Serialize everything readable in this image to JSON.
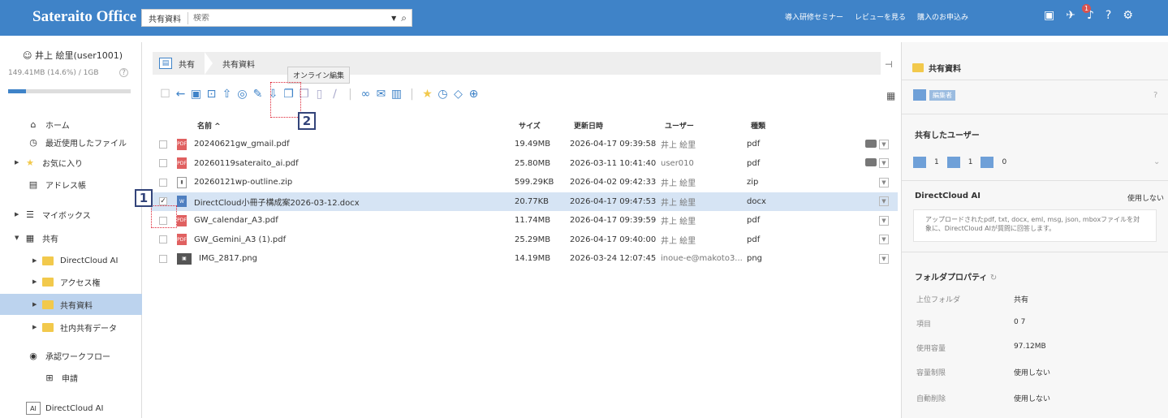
{
  "header": {
    "logo": "Sateraito Office",
    "scope": "共有資料",
    "search_placeholder": "検索",
    "links": [
      "導入研修セミナー",
      "レビューを見る",
      "購入のお申込み"
    ],
    "notif": "1"
  },
  "sidebar": {
    "user": "井上 絵里(user1001)",
    "quota": "149.41MB (14.6%) / 1GB",
    "quota_pct": 14.6,
    "items": [
      "ホーム",
      "最近使用したファイル",
      "お気に入り",
      "アドレス帳",
      "マイボックス",
      "共有",
      "DirectCloud AI",
      "アクセス権",
      "共有資料",
      "社内共有データ",
      "承認ワークフロー",
      "申請",
      "DirectCloud AI"
    ]
  },
  "breadcrumb": [
    "共有",
    "共有資料"
  ],
  "tooltip": "オンライン編集",
  "annotations": [
    "1",
    "2"
  ],
  "table": {
    "headers": [
      "名前 ^",
      "サイズ",
      "更新日時",
      "ユーザー",
      "種類"
    ],
    "rows": [
      {
        "name": "20240621gw_gmail.pdf",
        "size": "19.49MB",
        "date": "2026-04-17 09:39:58",
        "user": "井上 絵里",
        "type": "pdf"
      },
      {
        "name": "20260119sateraito_ai.pdf",
        "size": "25.80MB",
        "date": "2026-03-11 10:41:40",
        "user": "user010",
        "type": "pdf"
      },
      {
        "name": "20260121wp-outline.zip",
        "size": "599.29KB",
        "date": "2026-04-02 09:42:33",
        "user": "井上 絵里",
        "type": "zip"
      },
      {
        "name": "DirectCloud小冊子構成案2026-03-12.docx",
        "size": "20.77KB",
        "date": "2026-04-17 09:47:53",
        "user": "井上 絵里",
        "type": "docx"
      },
      {
        "name": "GW_calendar_A3.pdf",
        "size": "11.74MB",
        "date": "2026-04-17 09:39:59",
        "user": "井上 絵里",
        "type": "pdf"
      },
      {
        "name": "GW_Gemini_A3 (1).pdf",
        "size": "25.29MB",
        "date": "2026-04-17 09:40:00",
        "user": "井上 絵里",
        "type": "pdf"
      },
      {
        "name": "IMG_2817.png",
        "size": "14.19MB",
        "date": "2026-03-24 12:07:45",
        "user": "inoue-e@makoto3...",
        "type": "png"
      }
    ]
  },
  "panel": {
    "title": "共有資料",
    "badge": "編集者",
    "shared_title": "共有したユーザー",
    "counts": [
      "1",
      "1",
      "0"
    ],
    "ai_title": "DirectCloud AI",
    "ai_status": "使用しない",
    "ai_desc": "アップロードされたpdf, txt, docx, eml, msg, json, mboxファイルを対象に、DirectCloud AIが質問に回答します。",
    "props_title": "フォルダプロパティ",
    "props": [
      {
        "k": "上位フォルダ",
        "v": "共有"
      },
      {
        "k": "項目",
        "v": "0   7"
      },
      {
        "k": "使用容量",
        "v": "97.12MB"
      },
      {
        "k": "容量制限",
        "v": "使用しない"
      },
      {
        "k": "自動削除",
        "v": "使用しない"
      }
    ]
  }
}
